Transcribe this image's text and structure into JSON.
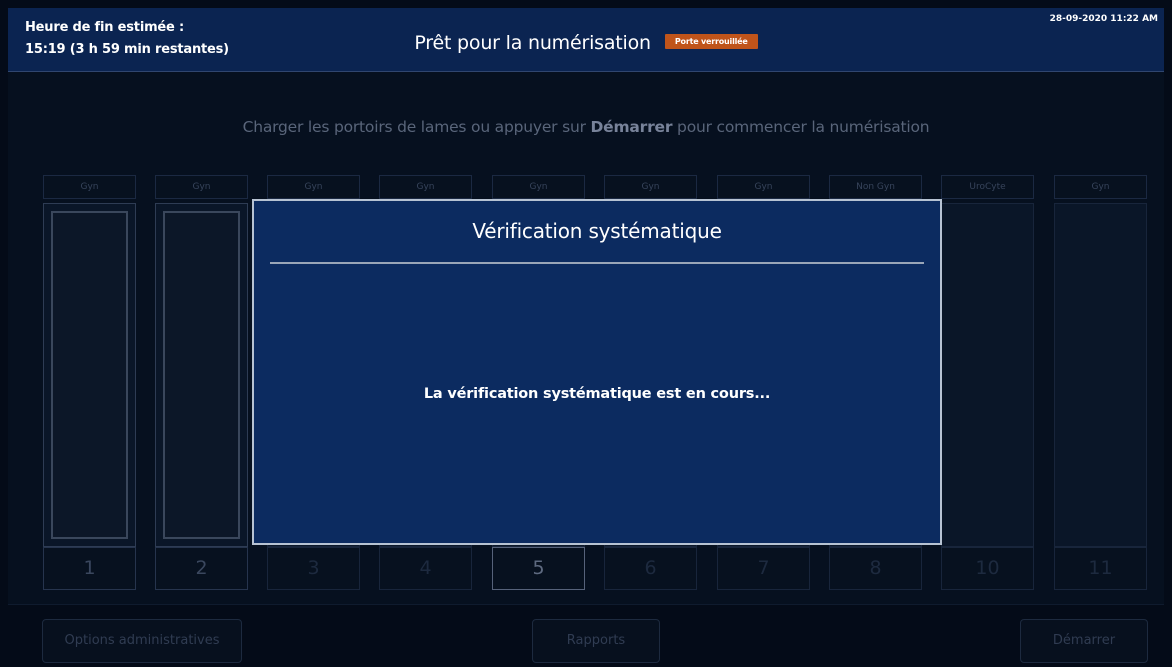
{
  "header": {
    "eta_label": "Heure de fin estimée :",
    "eta_value": "15:19 (3 h 59 min restantes)",
    "title": "Prêt pour la numérisation",
    "status_badge": "Porte verrouillée",
    "datetime": "28-09-2020 11:22 AM"
  },
  "main": {
    "instruction_before": "Charger les portoirs de lames ou appuyer sur ",
    "instruction_bold": "Démarrer",
    "instruction_after": " pour commencer la numérisation"
  },
  "racks": [
    {
      "type": "Gyn",
      "number": "1",
      "state": "loaded"
    },
    {
      "type": "Gyn",
      "number": "2",
      "state": "loaded"
    },
    {
      "type": "Gyn",
      "number": "3",
      "state": "empty"
    },
    {
      "type": "Gyn",
      "number": "4",
      "state": "empty"
    },
    {
      "type": "Gyn",
      "number": "5",
      "state": "active"
    },
    {
      "type": "Gyn",
      "number": "6",
      "state": "empty"
    },
    {
      "type": "Gyn",
      "number": "7",
      "state": "empty"
    },
    {
      "type": "Non Gyn",
      "number": "8",
      "state": "empty"
    },
    {
      "type": "UroCyte",
      "number": "10",
      "state": "empty"
    },
    {
      "type": "Gyn",
      "number": "11",
      "state": "empty"
    }
  ],
  "footer": {
    "admin_label": "Options administratives",
    "reports_label": "Rapports",
    "start_label": "Démarrer"
  },
  "modal": {
    "title": "Vérification systématique",
    "message": "La vérification systématique est en cours..."
  },
  "colors": {
    "header_bg": "#0b2451",
    "modal_bg": "#0c2b60",
    "badge": "#c0541a"
  }
}
